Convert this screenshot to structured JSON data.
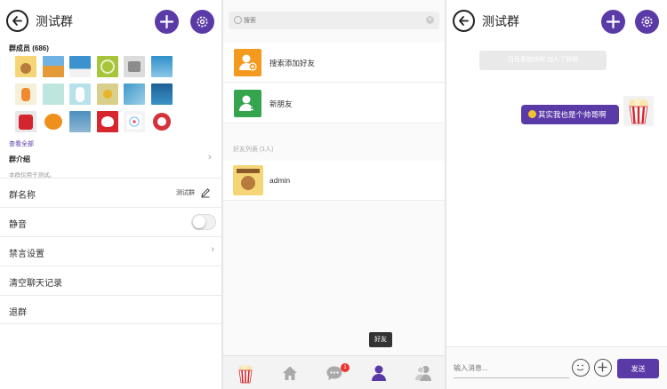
{
  "group_panel": {
    "title": "测试群",
    "members_label": "群成员 (686)",
    "see_all": "查看全部",
    "intro_label": "群介绍",
    "intro_text": "本群仅用于测试。",
    "rows": {
      "name_label": "群名称",
      "name_value": "测试群",
      "mute_label": "静音",
      "mute_on": false,
      "ban_label": "禁言设置",
      "clear_label": "清空聊天记录",
      "quit_label": "退群"
    },
    "member_avatars": [
      "cat-cartoon",
      "desert-dunes",
      "sky-landscape",
      "lime-fruit",
      "robot",
      "blue-sky",
      "fox-cartoon",
      "mint-pattern",
      "white-rabbit",
      "yellow-flower",
      "blue-pattern",
      "dark-blue",
      "red-bag",
      "pumpkin",
      "hand-photo",
      "red-heart",
      "confetti",
      "clown"
    ]
  },
  "contacts_panel": {
    "search_placeholder": "搜索",
    "items": [
      {
        "label": "搜索添加好友",
        "icon": "add-user-icon",
        "color": "#f39a1f"
      },
      {
        "label": "新朋友",
        "icon": "new-friend-icon",
        "color": "#35a44f"
      }
    ],
    "friends_header": "好友列表 (1人)",
    "friends": [
      {
        "name": "admin"
      }
    ],
    "tooltip": "好友",
    "tabs": [
      {
        "name": "popcorn-icon"
      },
      {
        "name": "home-icon"
      },
      {
        "name": "chat-icon",
        "badge": "1"
      },
      {
        "name": "friend-icon",
        "active": true
      },
      {
        "name": "group-icon"
      }
    ]
  },
  "chat_panel": {
    "title": "测试群",
    "system_message": "百岳君愉快啊 加入了群聊",
    "message": "其实我也是个帅哥啊",
    "input_placeholder": "输入消息...",
    "send_label": "发送"
  },
  "colors": {
    "accent": "#5a3aa7"
  }
}
